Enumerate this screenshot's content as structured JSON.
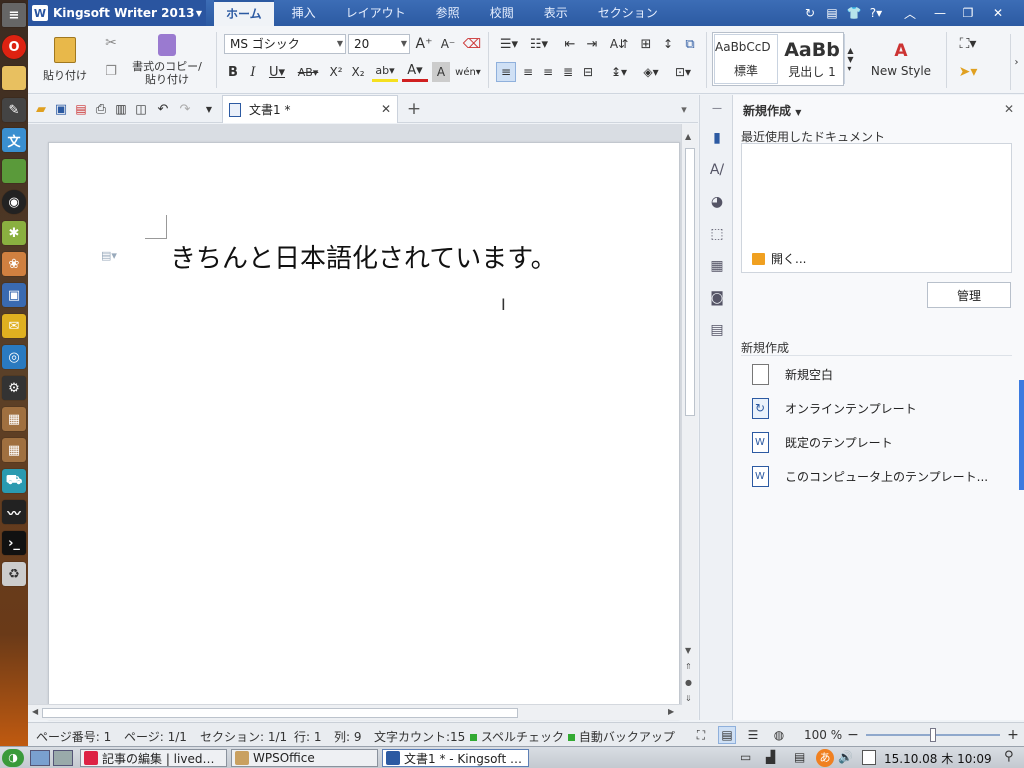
{
  "app": {
    "name": "Kingsoft Writer 2013",
    "menu_tabs": [
      "ホーム",
      "挿入",
      "レイアウト",
      "参照",
      "校閲",
      "表示",
      "セクション"
    ],
    "active_tab": "ホーム"
  },
  "ribbon": {
    "paste_label": "貼り付け",
    "format_copy_line1": "書式のコピー/",
    "format_copy_line2": "貼り付け",
    "font_name": "MS ゴシック",
    "font_size": "20",
    "style_normal_sample": "AaBbCcD",
    "style_normal_label": "標準",
    "style_heading_sample": "AaBb",
    "style_heading_label": "見出し 1",
    "new_style_label": "New Style"
  },
  "document": {
    "tab_title": "文書1 *",
    "body_text": "きちんと日本語化されています。"
  },
  "taskpane": {
    "title": "新規作成",
    "recent_section": "最近使用したドキュメント",
    "open_label": "開く...",
    "manage_button": "管理",
    "new_section": "新規作成",
    "templates": [
      "新規空白",
      "オンラインテンプレート",
      "既定のテンプレート",
      "このコンピュータ上のテンプレート..."
    ]
  },
  "status": {
    "page_number": "ページ番号: 1",
    "page": "ページ: 1/1",
    "section": "セクション: 1/1",
    "line": "行: 1",
    "column": "列: 9",
    "word_count": "文字カウント:15",
    "spell_check": "スペルチェック",
    "auto_backup": "自動バックアップ",
    "zoom": "100 %"
  },
  "taskbar": {
    "items": [
      "記事の編集 | lived…",
      "WPSOffice",
      "文書1 * - Kingsoft …"
    ],
    "clock": "15.10.08 木 10:09",
    "ime": "あ"
  },
  "colors": {
    "accent": "#2c5aa2",
    "title_bar": "#3c6db6"
  }
}
